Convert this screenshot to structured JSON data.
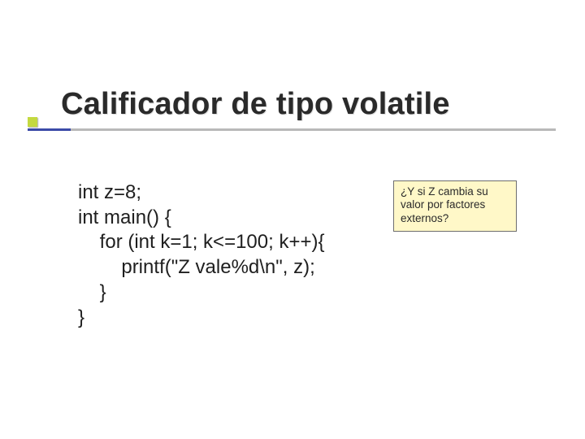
{
  "title": "Calificador de tipo volatile",
  "code": {
    "l1": "int z=8;",
    "l2": "int main() {",
    "l3": "    for (int k=1; k<=100; k++){",
    "l4": "        printf(\"Z vale%d\\n\", z);",
    "l5": "    }",
    "l6": "}"
  },
  "note": "¿Y si Z cambia su valor por factores externos?"
}
